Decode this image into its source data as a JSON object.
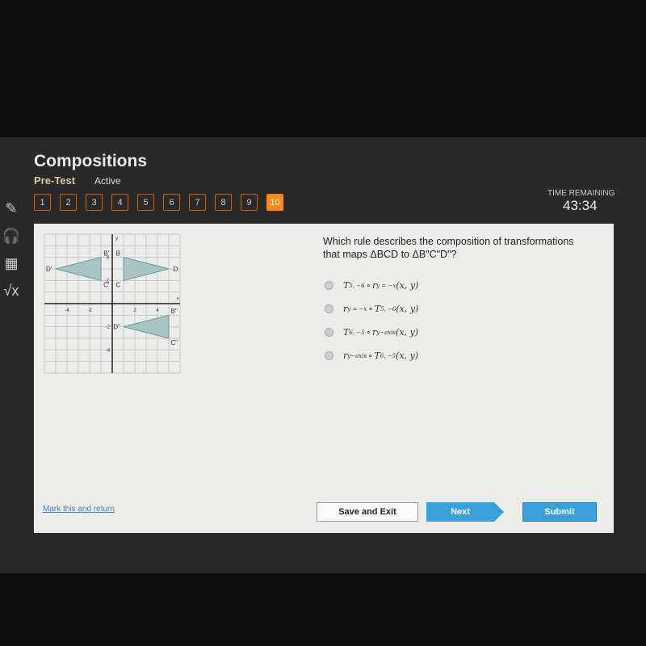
{
  "header": {
    "title": "Compositions",
    "mode": "Pre-Test",
    "status": "Active",
    "time_label": "TIME REMAINING",
    "time": "43:34"
  },
  "questions": [
    "1",
    "2",
    "3",
    "4",
    "5",
    "6",
    "7",
    "8",
    "9",
    "10"
  ],
  "current_question": "10",
  "tools": [
    {
      "name": "pencil-icon",
      "glyph": "✎"
    },
    {
      "name": "headphones-icon",
      "glyph": "🎧"
    },
    {
      "name": "calculator-icon",
      "glyph": "▦"
    },
    {
      "name": "square-root-icon",
      "glyph": "√x"
    }
  ],
  "question": "Which rule describes the composition of transformations that maps ΔBCD to ΔB\"C\"D\"?",
  "options": [
    {
      "f1": "T",
      "s1": "5, −6",
      "op": "∘",
      "f2": "r",
      "s2": "y = −x",
      "arg": "(x, y)"
    },
    {
      "f1": "r",
      "s1": "y = −x",
      "op": "∘",
      "f2": "T",
      "s2": "5, −6",
      "arg": "(x, y)"
    },
    {
      "f1": "T",
      "s1": "6, −5",
      "op": "∘",
      "f2": "r",
      "s2": "y−axis",
      "arg": "(x, y)"
    },
    {
      "f1": "r",
      "s1": "y−axis",
      "op": "∘",
      "f2": "T",
      "s2": "6, −5",
      "arg": "(x, y)"
    }
  ],
  "graph": {
    "xlabel": "x",
    "ylabel": "y",
    "xlim": [
      -6,
      6
    ],
    "ylim": [
      -6,
      6
    ],
    "x_ticks": [
      "-4",
      "-2",
      "2",
      "4"
    ],
    "y_ticks": [
      "4",
      "2",
      "-2",
      "-4"
    ],
    "fill": "#a9c4c4",
    "triangles": [
      {
        "labels": [
          "B",
          "C",
          "D"
        ],
        "points": [
          [
            1,
            4
          ],
          [
            1,
            2
          ],
          [
            5,
            3
          ]
        ]
      },
      {
        "labels": [
          "B'",
          "C'",
          "D'"
        ],
        "points": [
          [
            -1,
            4
          ],
          [
            -1,
            2
          ],
          [
            -5,
            3
          ]
        ]
      },
      {
        "labels": [
          "B\"",
          "C\"",
          "D\""
        ],
        "points": [
          [
            5,
            -1
          ],
          [
            5,
            -3
          ],
          [
            1,
            -2
          ]
        ]
      }
    ]
  },
  "footer": {
    "mark": "Mark this and return",
    "save": "Save and Exit",
    "next": "Next",
    "submit": "Submit"
  }
}
